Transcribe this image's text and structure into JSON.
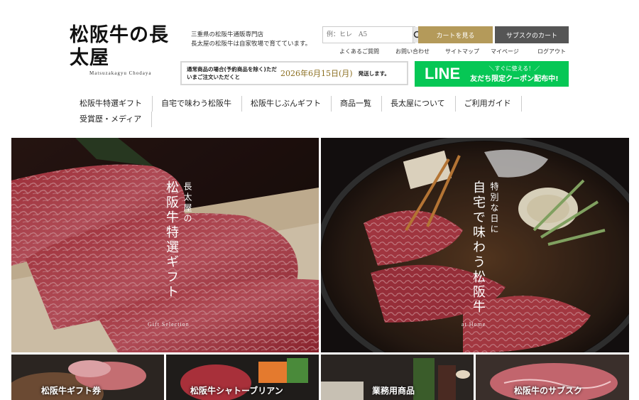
{
  "header": {
    "logo_text": "松阪牛の長太屋",
    "logo_sub": "Matsuzakagyu Chodaya",
    "tagline_line1": "三重県の松阪牛通販専門店",
    "tagline_line2": "長太屋の松阪牛は自家牧場で育てています。",
    "search_placeholder": "例：ヒレ　A5",
    "cart_label": "カートを見る",
    "subscription_cart_label": "サブスクのカート",
    "util_links": [
      "よくあるご質問",
      "お問い合わせ",
      "サイトマップ",
      "マイページ",
      "ログアウト"
    ]
  },
  "notice": {
    "condition": "通常商品の場合(予約商品を除く)ただいまご注文いただくと",
    "date": "2026年6月15日(月)",
    "tail": "発送します。"
  },
  "line_banner": {
    "logo": "LINE",
    "sub": "＼すぐに使える！／",
    "main": "友だち限定クーポン配布中!"
  },
  "nav": {
    "row1": [
      "松阪牛特選ギフト",
      "自宅で味わう松阪牛",
      "松阪牛じぶんギフト",
      "商品一覧",
      "長太屋について",
      "ご利用ガイド"
    ],
    "row2": [
      "受賞歴・メディア"
    ]
  },
  "hero": {
    "left_small": "長太屋の",
    "left_large": "松阪牛特選ギフト",
    "left_en": "Gift Selection",
    "right_small": "特別な日に",
    "right_large": "自宅で味わう松阪牛",
    "right_en": "at Home"
  },
  "tiles": [
    "松阪牛ギフト券",
    "松阪牛シャトーブリアン",
    "業務用商品",
    "松阪牛のサブスク"
  ],
  "colors": {
    "gold": "#b49a5a",
    "line_green": "#06c755",
    "dark_button": "#555555"
  }
}
